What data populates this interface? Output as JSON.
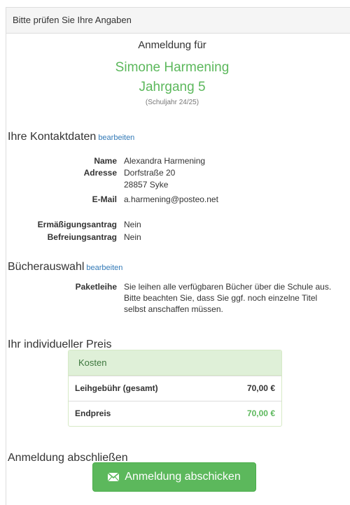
{
  "panel": {
    "title": "Bitte prüfen Sie Ihre Angaben"
  },
  "registration": {
    "title": "Anmeldung für",
    "name": "Simone Harmening",
    "grade": "Jahrgang 5",
    "school_year": "(Schuljahr 24/25)"
  },
  "contact": {
    "heading": "Ihre Kontaktdaten",
    "edit_label": "bearbeiten",
    "name_label": "Name",
    "name_value": "Alexandra Harmening",
    "address_label": "Adresse",
    "address_line1": "Dorfstraße 20",
    "address_line2": "28857 Syke",
    "email_label": "E-Mail",
    "email_value": "a.harmening@posteo.net",
    "reduction_label": "Ermäßigungsantrag",
    "reduction_value": "Nein",
    "exemption_label": "Befreiungsantrag",
    "exemption_value": "Nein"
  },
  "books": {
    "heading": "Bücherauswahl",
    "edit_label": "bearbeiten",
    "package_label": "Paketleihe",
    "package_text": "Sie leihen alle verfügbaren Bücher über die Schule aus. Bitte beachten Sie, dass Sie ggf. noch einzelne Titel selbst anschaffen müssen."
  },
  "price": {
    "heading": "Ihr individueller Preis",
    "table_title": "Kosten",
    "rows": [
      {
        "label": "Leihgebühr (gesamt)",
        "value": "70,00 €"
      },
      {
        "label": "Endpreis",
        "value": "70,00 €"
      }
    ]
  },
  "finish": {
    "heading": "Anmeldung abschließen",
    "submit_label": "Anmeldung abschicken"
  },
  "colors": {
    "accent_green": "#5cb85c",
    "link_blue": "#337ab7",
    "table_header_bg": "#dff0d8"
  }
}
